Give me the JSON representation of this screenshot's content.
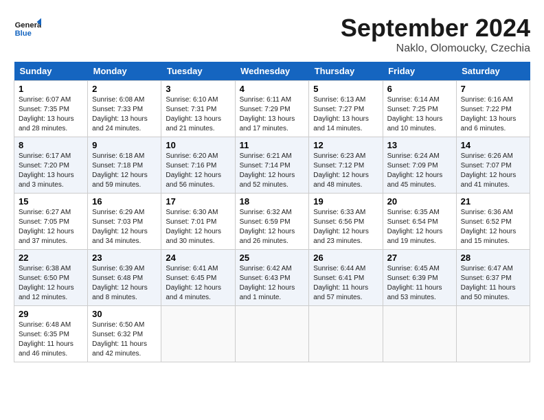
{
  "header": {
    "logo_general": "General",
    "logo_blue": "Blue",
    "month_title": "September 2024",
    "location": "Naklo, Olomoucky, Czechia"
  },
  "days_of_week": [
    "Sunday",
    "Monday",
    "Tuesday",
    "Wednesday",
    "Thursday",
    "Friday",
    "Saturday"
  ],
  "weeks": [
    [
      {
        "day": "1",
        "info": "Sunrise: 6:07 AM\nSunset: 7:35 PM\nDaylight: 13 hours\nand 28 minutes."
      },
      {
        "day": "2",
        "info": "Sunrise: 6:08 AM\nSunset: 7:33 PM\nDaylight: 13 hours\nand 24 minutes."
      },
      {
        "day": "3",
        "info": "Sunrise: 6:10 AM\nSunset: 7:31 PM\nDaylight: 13 hours\nand 21 minutes."
      },
      {
        "day": "4",
        "info": "Sunrise: 6:11 AM\nSunset: 7:29 PM\nDaylight: 13 hours\nand 17 minutes."
      },
      {
        "day": "5",
        "info": "Sunrise: 6:13 AM\nSunset: 7:27 PM\nDaylight: 13 hours\nand 14 minutes."
      },
      {
        "day": "6",
        "info": "Sunrise: 6:14 AM\nSunset: 7:25 PM\nDaylight: 13 hours\nand 10 minutes."
      },
      {
        "day": "7",
        "info": "Sunrise: 6:16 AM\nSunset: 7:22 PM\nDaylight: 13 hours\nand 6 minutes."
      }
    ],
    [
      {
        "day": "8",
        "info": "Sunrise: 6:17 AM\nSunset: 7:20 PM\nDaylight: 13 hours\nand 3 minutes."
      },
      {
        "day": "9",
        "info": "Sunrise: 6:18 AM\nSunset: 7:18 PM\nDaylight: 12 hours\nand 59 minutes."
      },
      {
        "day": "10",
        "info": "Sunrise: 6:20 AM\nSunset: 7:16 PM\nDaylight: 12 hours\nand 56 minutes."
      },
      {
        "day": "11",
        "info": "Sunrise: 6:21 AM\nSunset: 7:14 PM\nDaylight: 12 hours\nand 52 minutes."
      },
      {
        "day": "12",
        "info": "Sunrise: 6:23 AM\nSunset: 7:12 PM\nDaylight: 12 hours\nand 48 minutes."
      },
      {
        "day": "13",
        "info": "Sunrise: 6:24 AM\nSunset: 7:09 PM\nDaylight: 12 hours\nand 45 minutes."
      },
      {
        "day": "14",
        "info": "Sunrise: 6:26 AM\nSunset: 7:07 PM\nDaylight: 12 hours\nand 41 minutes."
      }
    ],
    [
      {
        "day": "15",
        "info": "Sunrise: 6:27 AM\nSunset: 7:05 PM\nDaylight: 12 hours\nand 37 minutes."
      },
      {
        "day": "16",
        "info": "Sunrise: 6:29 AM\nSunset: 7:03 PM\nDaylight: 12 hours\nand 34 minutes."
      },
      {
        "day": "17",
        "info": "Sunrise: 6:30 AM\nSunset: 7:01 PM\nDaylight: 12 hours\nand 30 minutes."
      },
      {
        "day": "18",
        "info": "Sunrise: 6:32 AM\nSunset: 6:59 PM\nDaylight: 12 hours\nand 26 minutes."
      },
      {
        "day": "19",
        "info": "Sunrise: 6:33 AM\nSunset: 6:56 PM\nDaylight: 12 hours\nand 23 minutes."
      },
      {
        "day": "20",
        "info": "Sunrise: 6:35 AM\nSunset: 6:54 PM\nDaylight: 12 hours\nand 19 minutes."
      },
      {
        "day": "21",
        "info": "Sunrise: 6:36 AM\nSunset: 6:52 PM\nDaylight: 12 hours\nand 15 minutes."
      }
    ],
    [
      {
        "day": "22",
        "info": "Sunrise: 6:38 AM\nSunset: 6:50 PM\nDaylight: 12 hours\nand 12 minutes."
      },
      {
        "day": "23",
        "info": "Sunrise: 6:39 AM\nSunset: 6:48 PM\nDaylight: 12 hours\nand 8 minutes."
      },
      {
        "day": "24",
        "info": "Sunrise: 6:41 AM\nSunset: 6:45 PM\nDaylight: 12 hours\nand 4 minutes."
      },
      {
        "day": "25",
        "info": "Sunrise: 6:42 AM\nSunset: 6:43 PM\nDaylight: 12 hours\nand 1 minute."
      },
      {
        "day": "26",
        "info": "Sunrise: 6:44 AM\nSunset: 6:41 PM\nDaylight: 11 hours\nand 57 minutes."
      },
      {
        "day": "27",
        "info": "Sunrise: 6:45 AM\nSunset: 6:39 PM\nDaylight: 11 hours\nand 53 minutes."
      },
      {
        "day": "28",
        "info": "Sunrise: 6:47 AM\nSunset: 6:37 PM\nDaylight: 11 hours\nand 50 minutes."
      }
    ],
    [
      {
        "day": "29",
        "info": "Sunrise: 6:48 AM\nSunset: 6:35 PM\nDaylight: 11 hours\nand 46 minutes."
      },
      {
        "day": "30",
        "info": "Sunrise: 6:50 AM\nSunset: 6:32 PM\nDaylight: 11 hours\nand 42 minutes."
      },
      {
        "day": "",
        "info": ""
      },
      {
        "day": "",
        "info": ""
      },
      {
        "day": "",
        "info": ""
      },
      {
        "day": "",
        "info": ""
      },
      {
        "day": "",
        "info": ""
      }
    ]
  ]
}
